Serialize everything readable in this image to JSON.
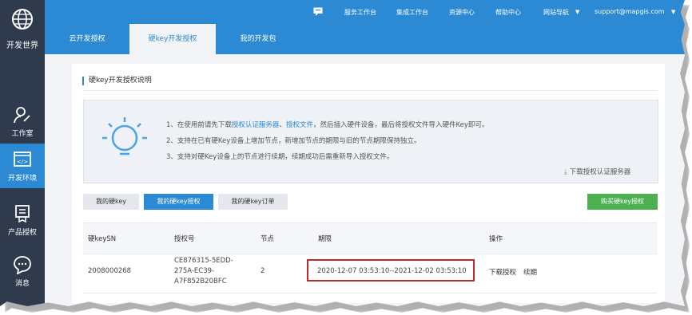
{
  "sidebar": {
    "logo_label": "开发世界",
    "items": [
      {
        "label": "工作室",
        "icon": "user-edit-icon"
      },
      {
        "label": "开发环境",
        "icon": "code-window-icon"
      },
      {
        "label": "产品授权",
        "icon": "certificate-icon"
      },
      {
        "label": "消息",
        "icon": "chat-bubble-icon"
      }
    ]
  },
  "topbar": {
    "links": [
      "服务工作台",
      "集成工作台",
      "资源中心",
      "帮助中心",
      "网站导航"
    ],
    "user": "support@mapgis.com"
  },
  "tabs": [
    "云开发授权",
    "硬key开发授权",
    "我的开发包"
  ],
  "section": {
    "title": "硬key开发授权说明"
  },
  "info": {
    "line1_prefix": "1、在使用前请先下载",
    "line1_link1": "授权认证服务器",
    "line1_sep": "、",
    "line1_link2": "授权文件",
    "line1_suffix": "，然后插入硬件设备，最后将授权文件导入硬件Key即可。",
    "line2": "2、支持在已有硬Key设备上增加节点，新增加节点的期限与旧的节点期限保持独立。",
    "line3": "3、支持对硬Key设备上的节点进行续期，续期成功后需重新导入授权文件。",
    "download": "下载授权认证服务器"
  },
  "subtabs": [
    "我的硬key",
    "我的硬key授权",
    "我的硬key订单"
  ],
  "buy_button": "购买硬key授权",
  "table": {
    "headers": [
      "硬keySN",
      "授权号",
      "节点",
      "期限",
      "操作"
    ],
    "row": {
      "sn": "2008000268",
      "auth_lines": [
        "CE876315-5EDD-",
        "275A-EC39-",
        "A7F852B20BFC"
      ],
      "nodes": "2",
      "period": "2020-12-07 03:53:10--2021-12-02 03:53:10",
      "actions": [
        "下载授权",
        "续期"
      ]
    }
  },
  "colors": {
    "brand": "#2c89d4",
    "sidebar": "#2f3a4d",
    "buy": "#4caf50",
    "highlight": "#c0282f"
  }
}
